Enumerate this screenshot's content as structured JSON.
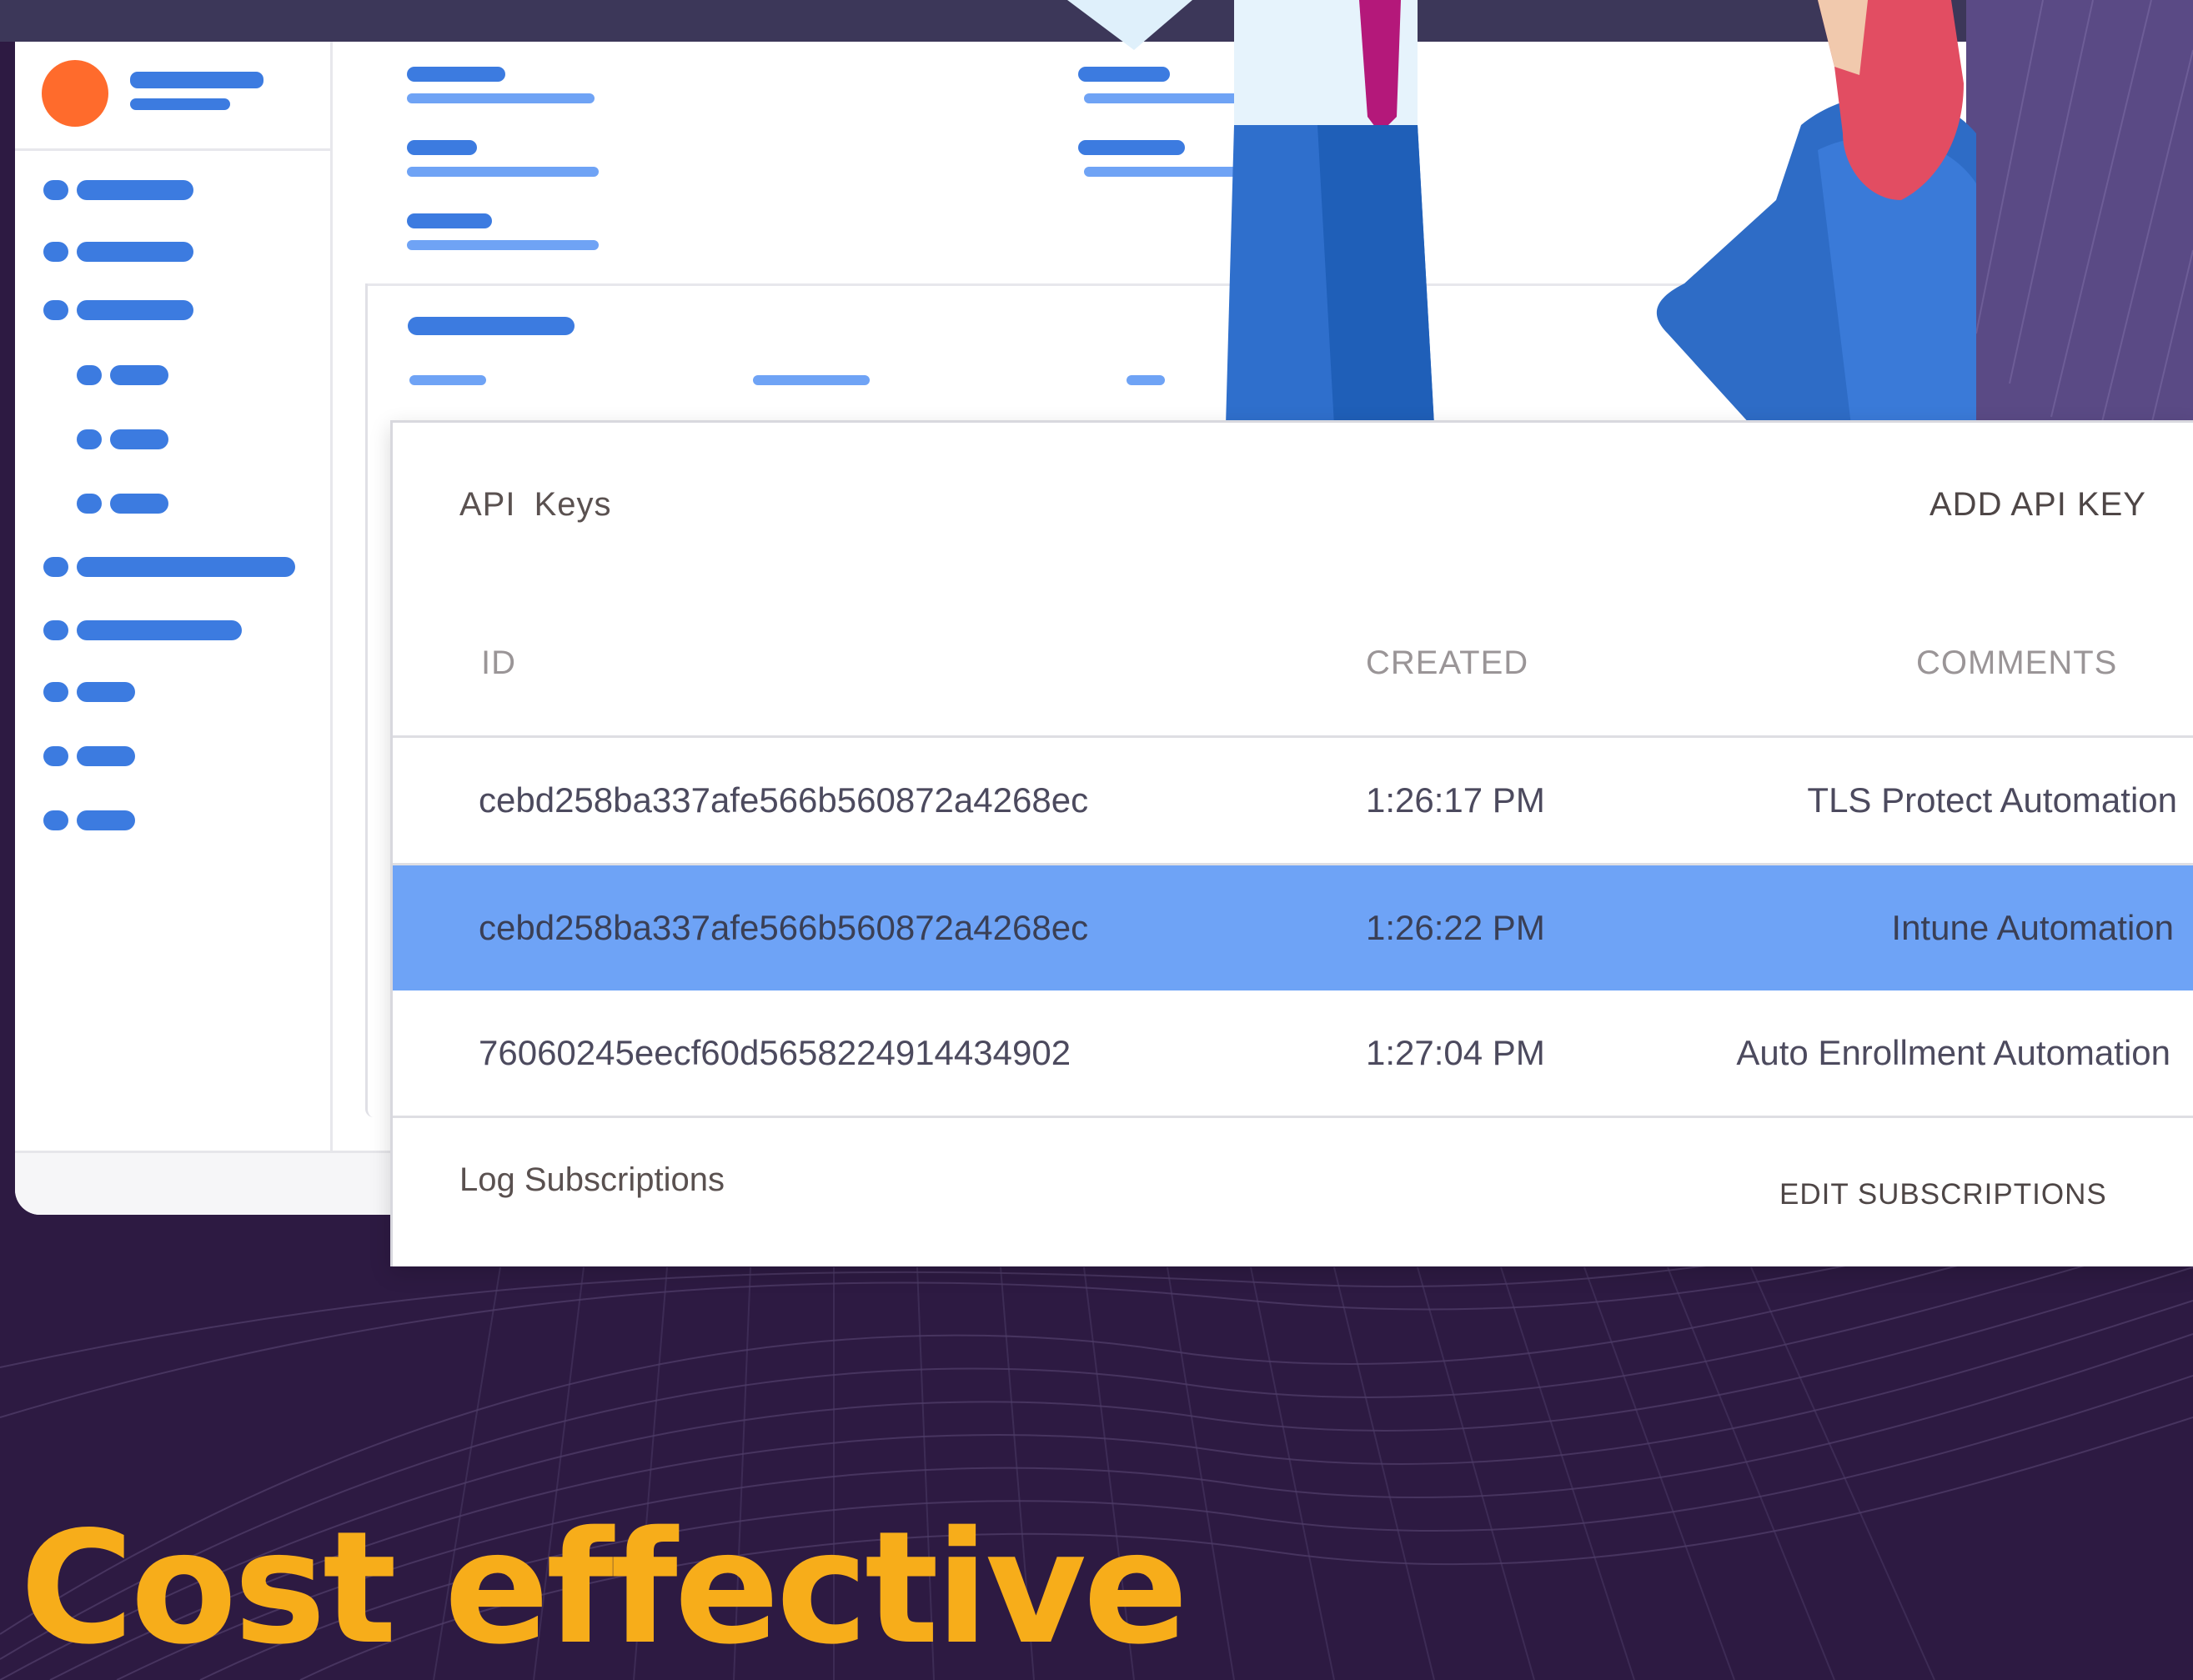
{
  "colors": {
    "background": "#2d1a42",
    "accent_blue": "#3c7be0",
    "selected_row": "#6ea3f6",
    "headline": "#f7ad1a",
    "avatar": "#ff6b2c"
  },
  "api_keys": {
    "title": "API  Keys",
    "add_label": "ADD API KEY",
    "columns": {
      "id": "ID",
      "created": "CREATED",
      "comments": "COMMENTS"
    },
    "rows": [
      {
        "id": "cebd258ba337afe566b560872a4268ec",
        "created": "1:26:17 PM",
        "comment": "TLS Protect Automation",
        "selected": false
      },
      {
        "id": "cebd258ba337afe566b560872a4268ec",
        "created": "1:26:22 PM",
        "comment": "Intune Automation",
        "selected": true
      },
      {
        "id": "76060245eecf60d5658224914434902",
        "created": "1:27:04 PM",
        "comment": "Auto Enrollment Automation",
        "selected": false
      }
    ]
  },
  "log_subscriptions": {
    "title": "Log Subscriptions",
    "edit_label": "EDIT SUBSCRIPTIONS"
  },
  "headline": "Cost effective",
  "icons": [
    "avatar-icon",
    "sidebar-bullet-icon"
  ]
}
